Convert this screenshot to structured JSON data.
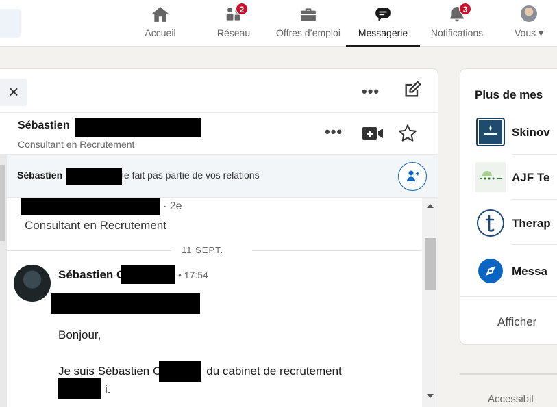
{
  "nav": {
    "items": [
      {
        "label": "Accueil",
        "icon": "home-icon"
      },
      {
        "label": "Réseau",
        "icon": "network-icon",
        "badge": "2"
      },
      {
        "label": "Offres d’emploi",
        "icon": "jobs-icon"
      },
      {
        "label": "Messagerie",
        "icon": "messaging-icon",
        "active": true
      },
      {
        "label": "Notifications",
        "icon": "bell-icon",
        "badge": "3"
      },
      {
        "label": "Vous",
        "icon": "avatar",
        "dropdown": true
      }
    ]
  },
  "panel": {
    "close_icon": "×",
    "more": "•••",
    "compose_icon": "compose-icon"
  },
  "contact": {
    "name": "Sébastien",
    "title": "Consultant en Recrutement",
    "more": "•••"
  },
  "relation": {
    "name": "Sébastien",
    "text": "ne fait pas partie de vos relations"
  },
  "thread": {
    "degree": "· 2e",
    "headline": "Consultant en Recrutement",
    "date": "11 SEPT.",
    "sender": "Sébastien C",
    "time": "• 17:54",
    "greeting": "Bonjour,",
    "line1_start": "Je suis Sébastien C",
    "line1_end": "du cabinet de recrutement",
    "line2_end": "i."
  },
  "right": {
    "title": "Plus de mes",
    "suggestions": [
      {
        "name": "Skinov",
        "icon": "skinoval-logo"
      },
      {
        "name": "AJF Te",
        "icon": "ajf-logo"
      },
      {
        "name": "Therap",
        "icon": "t-logo"
      },
      {
        "name": "Messa",
        "icon": "compass-logo"
      }
    ],
    "show_more": "Afficher",
    "footer": "Accessibil"
  },
  "colors": {
    "accent": "#0a66c2",
    "badge": "#cb112d",
    "redaction": "#000000"
  }
}
